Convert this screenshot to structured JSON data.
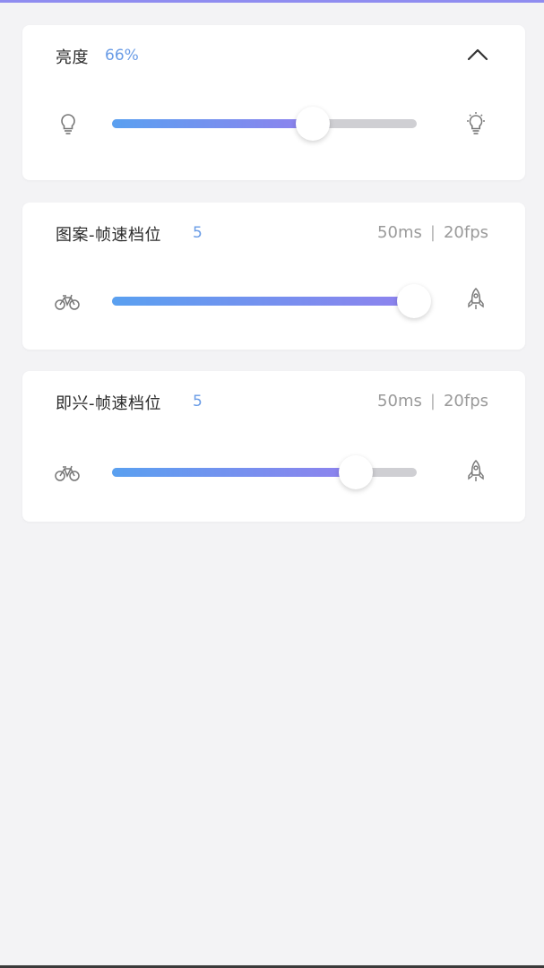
{
  "brightness": {
    "title": "亮度",
    "value_text": "66%",
    "level": 0.66,
    "left_icon": "bulb-icon",
    "right_icon": "bulb-bright-icon",
    "collapse_icon": "chevron-up-icon"
  },
  "pattern_speed": {
    "title": "图案-帧速档位",
    "value_text": "5",
    "interval": "50ms",
    "separator": "|",
    "fps": "20fps",
    "level": 1.0,
    "left_icon": "bicycle-icon",
    "right_icon": "rocket-icon"
  },
  "improv_speed": {
    "title": "即兴-帧速档位",
    "value_text": "5",
    "interval": "50ms",
    "separator": "|",
    "fps": "20fps",
    "level": 0.8,
    "left_icon": "bicycle-icon",
    "right_icon": "rocket-icon"
  },
  "colors": {
    "accent": "#6a9ce6",
    "fill_start": "#5aa0f0",
    "fill_end": "#8f82ee",
    "track": "#cfcfd3"
  }
}
